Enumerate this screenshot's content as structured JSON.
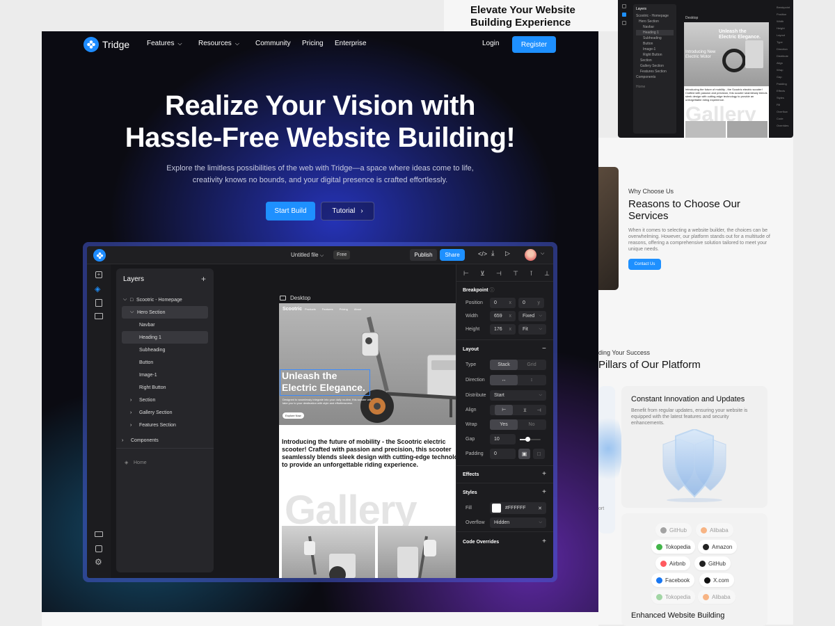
{
  "back_top": {
    "title": "Elevate Your Website Building Experience"
  },
  "back_editor": {
    "layers_label": "Layers",
    "items": [
      "Scootric - Homepage",
      "Hero Section",
      "Navbar",
      "Heading 1",
      "Subheading",
      "Button",
      "Image-1",
      "Right Button",
      "Section",
      "Gallery Section",
      "Features Section"
    ],
    "components": "Components",
    "home": "Home",
    "desktop": "Desktop",
    "hero_text": "Unleash the Electric Elegance.",
    "hero_sub": "Introducing New Electric Motor",
    "gallery": "Gallery",
    "body_text": "Introducing the future of mobility - the Scootric electric scooter! Crafted with passion and precision, this scooter seamlessly blends sleek design with cutting-edge technology to provide an unforgettable riding experience.",
    "props": [
      "Breakpoint",
      "Position",
      "Width",
      "Height",
      "Layout",
      "Type",
      "Direction",
      "Distribute",
      "Align",
      "Wrap",
      "Gap",
      "Padding",
      "Effects",
      "Styles",
      "Fill",
      "Overflow",
      "Code Overrides"
    ]
  },
  "why": {
    "eyebrow": "Why Choose Us",
    "title": "Reasons to Choose Our Services",
    "body": "When it comes to selecting a website builder, the choices can be overwhelming. However, our platform stands out for a multitude of reasons, offering a comprehensive solution tailored to meet your unique needs.",
    "cta": "Contact Us"
  },
  "pillars": {
    "eyebrow": "ding Your Success",
    "title": "Pillars of Our Platform",
    "card1_title": "Constant Innovation and Updates",
    "card1_body": "Benefit from regular updates, ensuring your website is equipped with the latest features and security enhancements.",
    "left_fragment": "ort",
    "card2_title": "Enhanced Website Building",
    "pills": [
      {
        "label": "GitHub",
        "color": "#444444"
      },
      {
        "label": "Alibaba",
        "color": "#ff6a00"
      },
      {
        "label": "Tokopedia",
        "color": "#42b549"
      },
      {
        "label": "Amazon",
        "color": "#222222"
      },
      {
        "label": "Airbnb",
        "color": "#ff5a5f"
      },
      {
        "label": "GitHub",
        "color": "#222222"
      },
      {
        "label": "Facebook",
        "color": "#1877f2"
      },
      {
        "label": "X.com",
        "color": "#111111"
      },
      {
        "label": "Tokopedia",
        "color": "#42b549"
      },
      {
        "label": "Alibaba",
        "color": "#ff6a00"
      }
    ]
  },
  "nav": {
    "brand": "Tridge",
    "items": [
      "Features",
      "Resources",
      "Community",
      "Pricing",
      "Enterprise"
    ],
    "login": "Login",
    "register": "Register"
  },
  "hero": {
    "title_line1": "Realize Your Vision with",
    "title_line2": "Hassle-Free Website Building!",
    "subtitle_line1": "Explore the limitless possibilities of the web with Tridge—a space where ideas come to life,",
    "subtitle_line2": "creativity knows no bounds, and your digital presence is crafted effortlessly.",
    "start_build": "Start Build",
    "tutorial": "Tutorial"
  },
  "editor": {
    "file_name": "Untitled file",
    "plan_badge": "Free",
    "publish": "Publish",
    "share": "Share",
    "layers_title": "Layers",
    "tree": {
      "root": "Scootric - Homepage",
      "hero": "Hero Section",
      "navbar": "Navbar",
      "heading": "Heading 1",
      "subheading": "Subheading",
      "button": "Button",
      "image": "Image-1",
      "right_button": "Right Button",
      "section": "Section",
      "gallery": "Gallery Section",
      "features": "Features Section",
      "components": "Components",
      "home": "Home"
    },
    "canvas": {
      "frame_label": "Desktop",
      "site_brand": "Scootric",
      "site_nav": [
        "Products",
        "Features",
        "Pricing",
        "About"
      ],
      "hero_line1": "Unleash the",
      "hero_line2": "Electric Elegance.",
      "hero_small": "Designed to seamlessly integrate into your daily routine, this scooter will take you to your destination with style and effortlessness.",
      "hero_button": "Explore Now",
      "intro": "Introducing the future of mobility - the Scootric electric scooter! Crafted with passion and precision, this scooter seamlessly blends sleek design with cutting-edge technology to provide an unforgettable riding experience.",
      "gallery_word": "Gallery"
    },
    "props": {
      "breakpoint": "Breakpoint",
      "position": "Position",
      "pos_x": "0",
      "pos_x_unit": "x",
      "pos_y": "0",
      "pos_y_unit": "y",
      "width": "Width",
      "width_val": "659",
      "width_unit": "x",
      "width_mode": "Fixed",
      "height": "Height",
      "height_val": "176",
      "height_unit": "x",
      "height_mode": "Fit",
      "layout": "Layout",
      "type": "Type",
      "type_stack": "Stack",
      "type_grid": "Grid",
      "direction": "Direction",
      "distribute": "Distribute",
      "distribute_val": "Start",
      "align": "Align",
      "wrap": "Wrap",
      "wrap_yes": "Yes",
      "wrap_no": "No",
      "gap": "Gap",
      "gap_val": "10",
      "gap_slider": 0.35,
      "padding": "Padding",
      "padding_val": "0",
      "effects": "Effects",
      "styles": "Styles",
      "fill": "Fill",
      "fill_val": "#FFFFFF",
      "overflow": "Overflow",
      "overflow_val": "Hidden",
      "code_overrides": "Code Overrides"
    }
  },
  "colors": {
    "accent": "#1e90ff",
    "dark": "#0b0b12",
    "panel": "#26262a"
  }
}
